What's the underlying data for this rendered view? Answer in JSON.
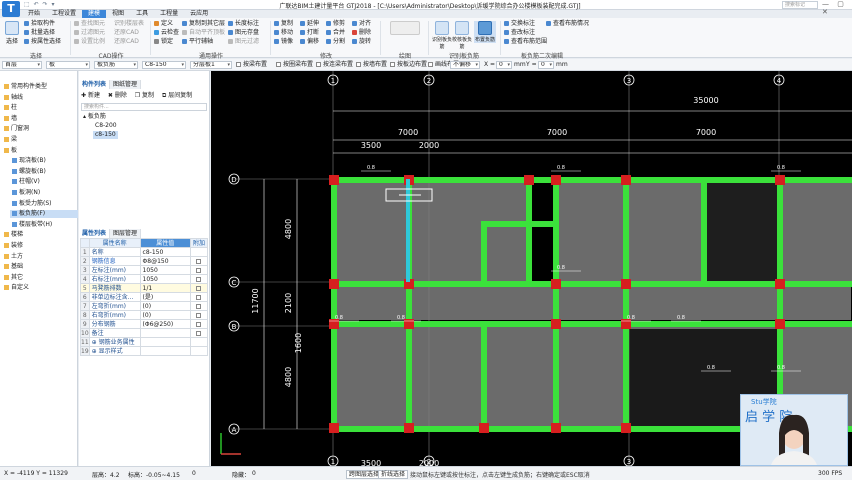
{
  "app": {
    "title": "广联达BIM土建计量平台 GTJ2018 - [C:\\Users\\Administrator\\Desktop\\诉缓学院综合办公楼模板装配完成.GTJ]",
    "search_placeholder": "搜索标记",
    "logo_letter": "T",
    "window_controls": "— ▢ ✕"
  },
  "menu_tabs": [
    "开始",
    "工程设置",
    "建模",
    "视图",
    "工具",
    "工程量",
    "云应用"
  ],
  "ribbon": {
    "select": "选择",
    "col1": [
      "拾取构件",
      "批量选择",
      "按属性选择"
    ],
    "col2": [
      "查找图元",
      "过滤图元",
      "设置比例"
    ],
    "col3": [
      "识别楼层表",
      "还原CAD",
      "还原CAD"
    ],
    "col4": [
      "定义",
      "云检查",
      "锁定"
    ],
    "col5": [
      "复制到其它层",
      "自动平齐顶板",
      "平行辅轴"
    ],
    "col6": [
      "长度标注",
      "图元存盘",
      "图元过滤"
    ],
    "col7": [
      "复制",
      "移动",
      "镜像"
    ],
    "col8": [
      "延伸",
      "打断",
      "偏移"
    ],
    "col9": [
      "修剪",
      "合并",
      "分割"
    ],
    "col10": [
      "对齐",
      "删除",
      "旋转"
    ],
    "draw_label": "绘图",
    "recog_buttons": [
      "识别板负筋",
      "校核板负筋",
      "布置负筋"
    ],
    "col11": [
      "交换标注",
      "查改标注",
      "查看布筋范围"
    ],
    "col12": [
      "查看布筋情况"
    ],
    "groups": [
      "选择",
      "CAD操作",
      "通用操作",
      "修改",
      "绘图",
      "识别板负筋",
      "板负筋二次编辑"
    ]
  },
  "toolbar2": {
    "floor": "首层",
    "category": "板",
    "member_type": "板负筋",
    "member": "C8-150",
    "layer": "分层板1",
    "options": [
      "按梁布置",
      "按圈梁布置",
      "按连梁布置",
      "按墙布置",
      "按板边布置",
      "画线布置"
    ],
    "offset_mode": "不偏移",
    "x_label": "X =",
    "x_value": "0",
    "mm1": "mm",
    "y_label": "Y =",
    "y_value": "0",
    "mm2": "mm"
  },
  "nav_tree": [
    {
      "label": "常用构件类型",
      "type": "folder"
    },
    {
      "label": "轴线",
      "type": "folder"
    },
    {
      "label": "柱",
      "type": "folder"
    },
    {
      "label": "墙",
      "type": "folder"
    },
    {
      "label": "门窗洞",
      "type": "folder"
    },
    {
      "label": "梁",
      "type": "folder"
    },
    {
      "label": "板",
      "type": "folder"
    },
    {
      "label": "现浇板(B)",
      "type": "leaf"
    },
    {
      "label": "螺旋板(B)",
      "type": "leaf"
    },
    {
      "label": "柱帽(V)",
      "type": "leaf"
    },
    {
      "label": "板洞(N)",
      "type": "leaf"
    },
    {
      "label": "板受力筋(S)",
      "type": "leaf"
    },
    {
      "label": "板负筋(F)",
      "type": "leaf",
      "selected": true
    },
    {
      "label": "楼层板带(H)",
      "type": "leaf"
    },
    {
      "label": "楼梯",
      "type": "folder"
    },
    {
      "label": "装修",
      "type": "folder"
    },
    {
      "label": "土方",
      "type": "folder"
    },
    {
      "label": "基础",
      "type": "folder"
    },
    {
      "label": "其它",
      "type": "folder"
    },
    {
      "label": "自定义",
      "type": "folder"
    }
  ],
  "component_panel": {
    "tabs": [
      "构件列表",
      "图纸管理"
    ],
    "tools": [
      "新建",
      "删除",
      "复制",
      "层间复制"
    ],
    "search_placeholder": "搜索构件...",
    "root": "板负筋",
    "items": [
      "C8-200",
      "c8-150"
    ]
  },
  "property_panel": {
    "tabs": [
      "属性列表",
      "图层管理"
    ],
    "headers": [
      "属性名称",
      "属性值",
      "附加"
    ],
    "rows": [
      {
        "n": "1",
        "name": "名称",
        "value": "c8-150",
        "check": false,
        "blue": false
      },
      {
        "n": "2",
        "name": "钢筋信息",
        "value": "Φ8@150",
        "check": true,
        "blue": true
      },
      {
        "n": "3",
        "name": "左标注(mm)",
        "value": "1050",
        "check": true,
        "blue": false
      },
      {
        "n": "4",
        "name": "右标注(mm)",
        "value": "1050",
        "check": true,
        "blue": false
      },
      {
        "n": "5",
        "name": "马凳筋排数",
        "value": "1/1",
        "check": true,
        "blue": false,
        "hi": true
      },
      {
        "n": "6",
        "name": "非单边标注含...",
        "value": "(是)",
        "check": true,
        "blue": false
      },
      {
        "n": "7",
        "name": "左弯折(mm)",
        "value": "(0)",
        "check": true,
        "blue": false
      },
      {
        "n": "8",
        "name": "右弯折(mm)",
        "value": "(0)",
        "check": true,
        "blue": false
      },
      {
        "n": "9",
        "name": "分布钢筋",
        "value": "(Φ6@250)",
        "check": true,
        "blue": false
      },
      {
        "n": "10",
        "name": "备注",
        "value": "",
        "check": true,
        "blue": false
      },
      {
        "n": "11",
        "name": "⊕ 钢筋业务属性",
        "value": "",
        "check": false,
        "blue": false
      },
      {
        "n": "19",
        "name": "⊕ 显示样式",
        "value": "",
        "check": false,
        "blue": false
      }
    ]
  },
  "drawing": {
    "axis_top": [
      "1",
      "2",
      "3",
      "4"
    ],
    "axis_bottom": [
      "1",
      "2",
      "3",
      "4"
    ],
    "axis_left": [
      "D",
      "C",
      "B",
      "A"
    ],
    "dim_total": "35000",
    "dim_spans": [
      "7000",
      "7000",
      "7000"
    ],
    "dim_sub": [
      "3500",
      "2000"
    ],
    "dim_bottom": [
      "3500",
      "2000"
    ],
    "dim_left_total": "11700",
    "dim_left": [
      "4800",
      "2100",
      "1600",
      "4800"
    ],
    "rebar_labels": [
      "0.8",
      "0.8",
      "0.8",
      "0.8",
      "0.8",
      "0.8",
      "0.8",
      "0.8",
      "0.8",
      "0.8"
    ],
    "close_icon": "✕"
  },
  "webcam": {
    "brand": "Stu学院",
    "text": "启 学 院"
  },
  "status": {
    "coord": "X = -4119 Y = 11329",
    "floor_height": "层高：4.2",
    "elevation": "标高：-0.05~4.15",
    "zero": "0",
    "hidden": "隐藏：",
    "hidden_val": "0",
    "btn1": "跨图层选择",
    "btn2": "折线选择",
    "hint": "接动鼠标左键或按住标注，点击左键生成负筋；右键确定或ESC取消",
    "fps": "300 FPS"
  }
}
